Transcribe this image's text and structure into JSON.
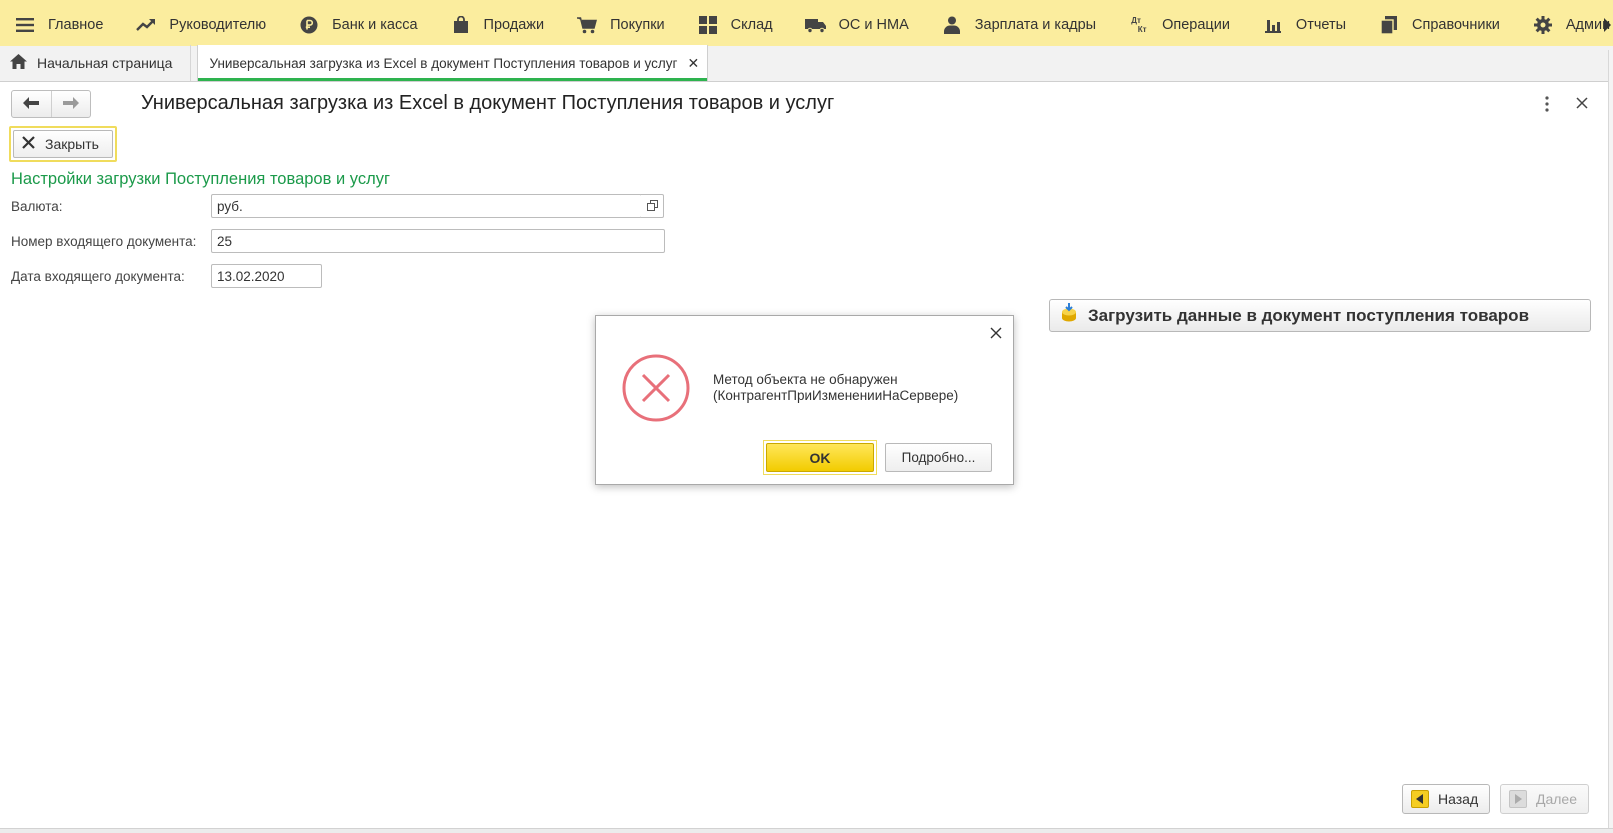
{
  "menu": {
    "items": [
      {
        "label": "Главное",
        "icon": "hamburger-icon"
      },
      {
        "label": "Руководителю",
        "icon": "trend-up-icon"
      },
      {
        "label": "Банк и касса",
        "icon": "ruble-coin-icon"
      },
      {
        "label": "Продажи",
        "icon": "shopping-bag-icon"
      },
      {
        "label": "Покупки",
        "icon": "cart-icon"
      },
      {
        "label": "Склад",
        "icon": "grid-icon"
      },
      {
        "label": "ОС и НМА",
        "icon": "truck-icon"
      },
      {
        "label": "Зарплата и кадры",
        "icon": "person-icon"
      },
      {
        "label": "Операции",
        "icon": "dt-kt-icon"
      },
      {
        "label": "Отчеты",
        "icon": "bar-chart-icon"
      },
      {
        "label": "Справочники",
        "icon": "books-icon"
      },
      {
        "label": "Админ",
        "icon": "gear-icon"
      }
    ],
    "dt_text": "Дт",
    "kt_text": "Кт"
  },
  "tabs": {
    "home_label": "Начальная страница",
    "active_label": "Универсальная загрузка из Excel в документ Поступления товаров и услуг",
    "close_glyph": "✕"
  },
  "form": {
    "title": "Универсальная загрузка из Excel в документ Поступления товаров и услуг",
    "close_button_label": "Закрыть",
    "section_title": "Настройки загрузки Поступления товаров и услуг",
    "fields": {
      "currency_label": "Валюта:",
      "currency_value": "руб.",
      "doc_number_label": "Номер входящего документа:",
      "doc_number_value": "25",
      "doc_date_label": "Дата входящего документа:",
      "doc_date_value": "13.02.2020"
    },
    "load_button_label": "Загрузить данные в документ поступления товаров",
    "back_button_label": "Назад",
    "next_button_label": "Далее"
  },
  "dialog": {
    "message_line1": "Метод объекта не обнаружен",
    "message_line2": "(КонтрагентПриИзмененииНаСервере)",
    "ok_label": "OK",
    "details_label": "Подробно..."
  },
  "colors": {
    "menu_bg": "#fbed9e",
    "accent_green": "#1b9a4a",
    "tab_underline": "#2eb34f",
    "ok_yellow": "#f2cc00",
    "error_red": "#e8707a"
  }
}
